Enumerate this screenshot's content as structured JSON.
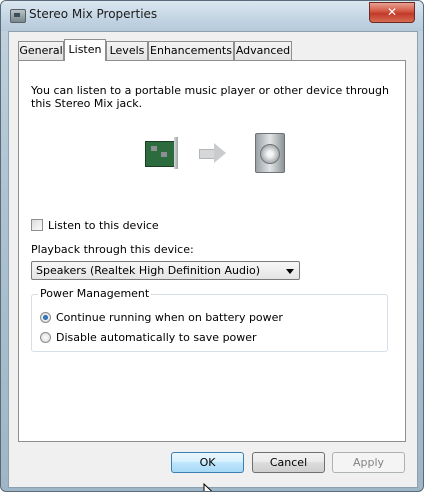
{
  "window": {
    "title": "Stereo Mix Properties",
    "close_glyph": "✕"
  },
  "tabs": [
    {
      "label": "General"
    },
    {
      "label": "Listen",
      "active": true
    },
    {
      "label": "Levels"
    },
    {
      "label": "Enhancements"
    },
    {
      "label": "Advanced"
    }
  ],
  "listen": {
    "description": "You can listen to a portable music player or other device through this Stereo Mix jack.",
    "listen_checkbox": {
      "label": "Listen to this device",
      "checked": false
    },
    "playback_label": "Playback through this device:",
    "playback_selected": "Speakers (Realtek High Definition Audio)"
  },
  "power": {
    "legend": "Power Management",
    "options": [
      {
        "label": "Continue running when on battery power",
        "selected": true
      },
      {
        "label": "Disable automatically to save power",
        "selected": false
      }
    ]
  },
  "buttons": {
    "ok": "OK",
    "cancel": "Cancel",
    "apply": "Apply"
  },
  "icons": {
    "app": "sound-card-icon",
    "source": "sound-card-icon",
    "arrow": "arrow-right-icon",
    "target": "speaker-icon"
  }
}
